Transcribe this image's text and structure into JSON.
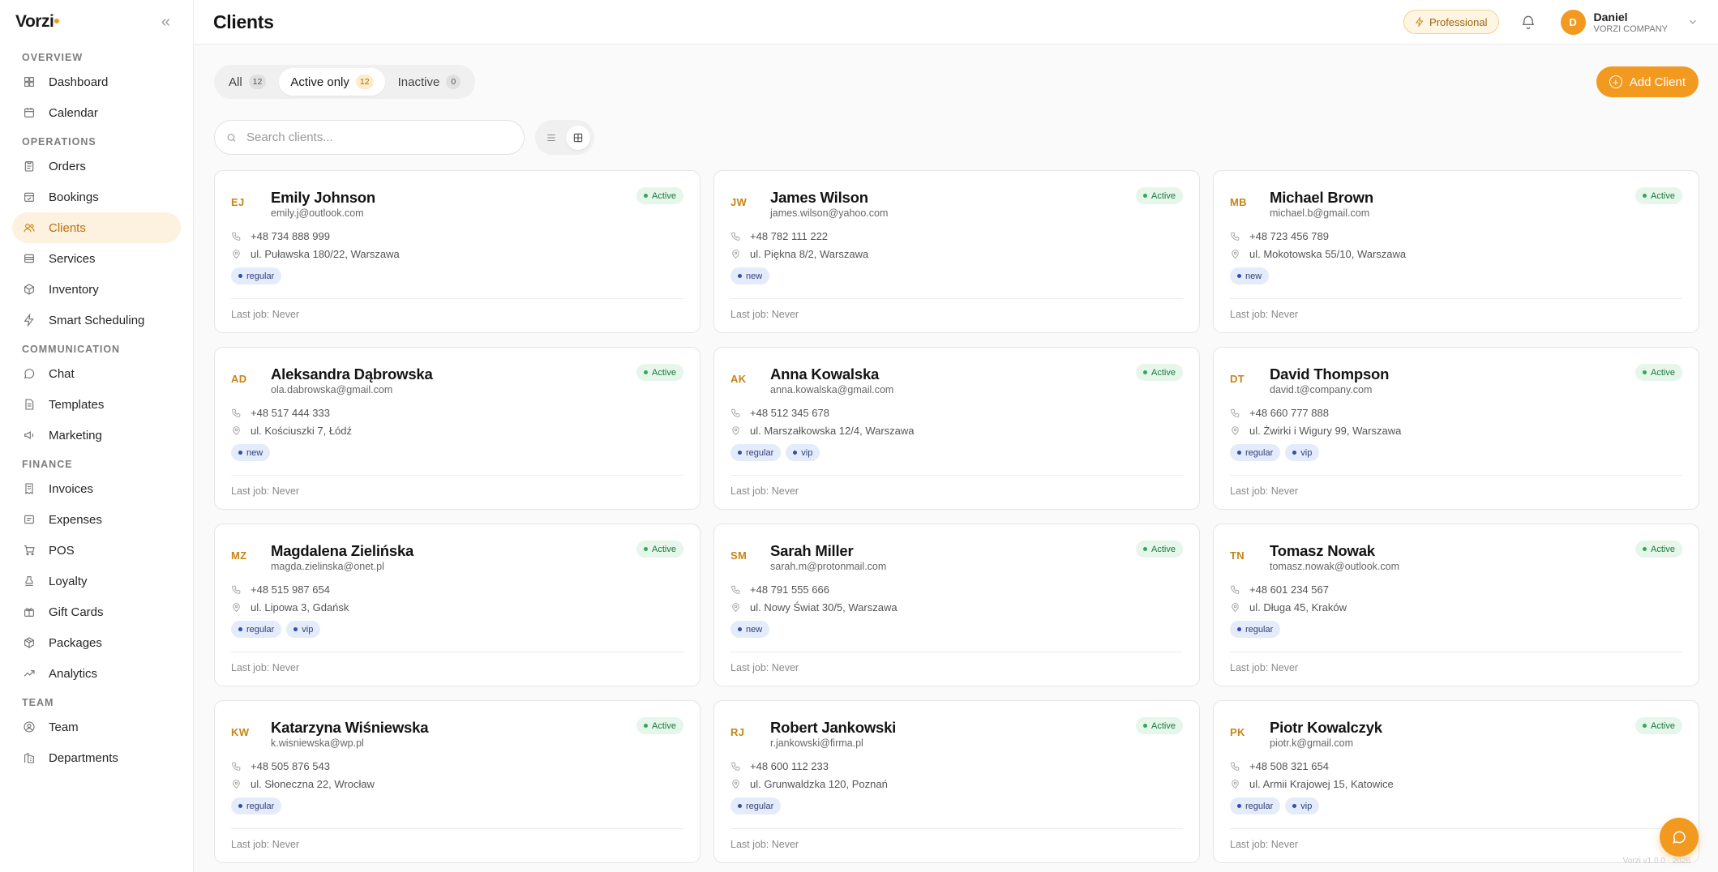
{
  "brand": {
    "logo_text": "Vorzi"
  },
  "sidebar": {
    "sections": [
      {
        "label": "OVERVIEW",
        "items": [
          {
            "label": "Dashboard",
            "icon": "dashboard-icon"
          },
          {
            "label": "Calendar",
            "icon": "calendar-icon"
          }
        ]
      },
      {
        "label": "OPERATIONS",
        "items": [
          {
            "label": "Orders",
            "icon": "clipboard-icon"
          },
          {
            "label": "Bookings",
            "icon": "calendar-check-icon"
          },
          {
            "label": "Clients",
            "icon": "users-icon",
            "active": true
          },
          {
            "label": "Services",
            "icon": "layers-icon"
          },
          {
            "label": "Inventory",
            "icon": "box-icon"
          },
          {
            "label": "Smart Scheduling",
            "icon": "bolt-icon"
          }
        ]
      },
      {
        "label": "COMMUNICATION",
        "items": [
          {
            "label": "Chat",
            "icon": "chat-icon"
          },
          {
            "label": "Templates",
            "icon": "document-icon"
          },
          {
            "label": "Marketing",
            "icon": "megaphone-icon"
          }
        ]
      },
      {
        "label": "FINANCE",
        "items": [
          {
            "label": "Invoices",
            "icon": "invoice-icon"
          },
          {
            "label": "Expenses",
            "icon": "receipt-icon"
          },
          {
            "label": "POS",
            "icon": "cart-icon"
          },
          {
            "label": "Loyalty",
            "icon": "stamp-icon"
          },
          {
            "label": "Gift Cards",
            "icon": "gift-icon"
          },
          {
            "label": "Packages",
            "icon": "package-icon"
          },
          {
            "label": "Analytics",
            "icon": "trend-icon"
          }
        ]
      },
      {
        "label": "TEAM",
        "items": [
          {
            "label": "Team",
            "icon": "user-circle-icon"
          },
          {
            "label": "Departments",
            "icon": "building-icon"
          }
        ]
      }
    ]
  },
  "header": {
    "title": "Clients",
    "plan": "Professional",
    "user": {
      "initial": "D",
      "name": "Daniel",
      "company": "VORZI COMPANY"
    }
  },
  "filters": {
    "tabs": [
      {
        "label": "All",
        "count": "12",
        "active": false
      },
      {
        "label": "Active only",
        "count": "12",
        "active": true
      },
      {
        "label": "Inactive",
        "count": "0",
        "active": false
      }
    ],
    "add_label": "Add Client",
    "search_placeholder": "Search clients..."
  },
  "clients": [
    {
      "initials": "EJ",
      "name": "Emily Johnson",
      "email": "emily.j@outlook.com",
      "status": "Active",
      "phone": "+48 734 888 999",
      "address": "ul. Puławska 180/22, Warszawa",
      "tags": [
        "regular"
      ],
      "last_job": "Last job: Never"
    },
    {
      "initials": "JW",
      "name": "James Wilson",
      "email": "james.wilson@yahoo.com",
      "status": "Active",
      "phone": "+48 782 111 222",
      "address": "ul. Piękna 8/2, Warszawa",
      "tags": [
        "new"
      ],
      "last_job": "Last job: Never"
    },
    {
      "initials": "MB",
      "name": "Michael Brown",
      "email": "michael.b@gmail.com",
      "status": "Active",
      "phone": "+48 723 456 789",
      "address": "ul. Mokotowska 55/10, Warszawa",
      "tags": [
        "new"
      ],
      "last_job": "Last job: Never"
    },
    {
      "initials": "AD",
      "name": "Aleksandra Dąbrowska",
      "email": "ola.dabrowska@gmail.com",
      "status": "Active",
      "phone": "+48 517 444 333",
      "address": "ul. Kościuszki 7, Łódź",
      "tags": [
        "new"
      ],
      "last_job": "Last job: Never"
    },
    {
      "initials": "AK",
      "name": "Anna Kowalska",
      "email": "anna.kowalska@gmail.com",
      "status": "Active",
      "phone": "+48 512 345 678",
      "address": "ul. Marszałkowska 12/4, Warszawa",
      "tags": [
        "regular",
        "vip"
      ],
      "last_job": "Last job: Never"
    },
    {
      "initials": "DT",
      "name": "David Thompson",
      "email": "david.t@company.com",
      "status": "Active",
      "phone": "+48 660 777 888",
      "address": "ul. Żwirki i Wigury 99, Warszawa",
      "tags": [
        "regular",
        "vip"
      ],
      "last_job": "Last job: Never"
    },
    {
      "initials": "MZ",
      "name": "Magdalena Zielińska",
      "email": "magda.zielinska@onet.pl",
      "status": "Active",
      "phone": "+48 515 987 654",
      "address": "ul. Lipowa 3, Gdańsk",
      "tags": [
        "regular",
        "vip"
      ],
      "last_job": "Last job: Never"
    },
    {
      "initials": "SM",
      "name": "Sarah Miller",
      "email": "sarah.m@protonmail.com",
      "status": "Active",
      "phone": "+48 791 555 666",
      "address": "ul. Nowy Świat 30/5, Warszawa",
      "tags": [
        "new"
      ],
      "last_job": "Last job: Never"
    },
    {
      "initials": "TN",
      "name": "Tomasz Nowak",
      "email": "tomasz.nowak@outlook.com",
      "status": "Active",
      "phone": "+48 601 234 567",
      "address": "ul. Długa 45, Kraków",
      "tags": [
        "regular"
      ],
      "last_job": "Last job: Never"
    },
    {
      "initials": "KW",
      "name": "Katarzyna Wiśniewska",
      "email": "k.wisniewska@wp.pl",
      "status": "Active",
      "phone": "+48 505 876 543",
      "address": "ul. Słoneczna 22, Wrocław",
      "tags": [
        "regular"
      ],
      "last_job": "Last job: Never"
    },
    {
      "initials": "RJ",
      "name": "Robert Jankowski",
      "email": "r.jankowski@firma.pl",
      "status": "Active",
      "phone": "+48 600 112 233",
      "address": "ul. Grunwaldzka 120, Poznań",
      "tags": [
        "regular"
      ],
      "last_job": "Last job: Never"
    },
    {
      "initials": "PK",
      "name": "Piotr Kowalczyk",
      "email": "piotr.k@gmail.com",
      "status": "Active",
      "phone": "+48 508 321 654",
      "address": "ul. Armii Krajowej 15, Katowice",
      "tags": [
        "regular",
        "vip"
      ],
      "last_job": "Last job: Never"
    }
  ],
  "footer": {
    "version": "Vorzi v1.0.0 · 2026"
  },
  "colors": {
    "accent": "#f29a1f",
    "active_status": "#1b7a3d",
    "tag": "#2d3f7a"
  }
}
